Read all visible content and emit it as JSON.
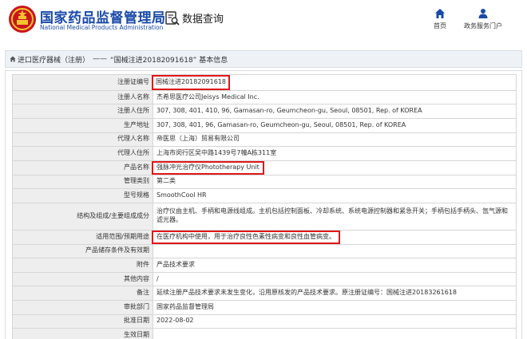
{
  "header": {
    "site_name_cn": "国家药品监督管理局",
    "site_name_en": "National Medical Products Administration",
    "data_query": "数据查询",
    "nav_home": "首页",
    "nav_portal": "政务服务门户"
  },
  "colors": {
    "brand": "#1a4aa8",
    "highlight": "#e0171b",
    "label_bg": "#eeeeee"
  },
  "breadcrumb": {
    "icon": "home-icon",
    "section": "进口医疗器械（注册）",
    "separator": "——",
    "current": "“国械注进20182091618” 基本信息"
  },
  "rows": [
    {
      "label": "注册证编号",
      "value": "国械注进20182091618"
    },
    {
      "label": "注册人名称",
      "value": "杰希思医疗公司Jeisys Medical Inc."
    },
    {
      "label": "注册人住所",
      "value": "307, 308, 401, 410, 96, Gamasan-ro, Geumcheon-gu, Seoul, 08501, Rep. of KOREA"
    },
    {
      "label": "生产地址",
      "value": "307, 308, 401, 96, Gamasan-ro, Geumcheon-gu, Seoul, 08501, Rep. of KOREA"
    },
    {
      "label": "代理人名称",
      "value": "帝医思（上海）贸易有限公司"
    },
    {
      "label": "代理人住所",
      "value": "上海市闵行区吴中路1439号7幢A栋311室"
    },
    {
      "label": "产品名称",
      "value": "强脉冲光治疗仪Phototherapy Unit"
    },
    {
      "label": "管理类别",
      "value": "第二类"
    },
    {
      "label": "型号规格",
      "value": "SmoothCool HR"
    },
    {
      "label": "结构及组成/主要组成成分",
      "value": "治疗仪由主机、手柄和电源线组成。主机包括控制面板、冷却系统、系统电源控制器和紧急开关；手柄包括手柄头、氙气源和滤光器。"
    },
    {
      "label": "适用范围/预期用途",
      "value": "在医疗机构中使用，用于治疗良性色素性病变和良性血管病变。"
    },
    {
      "label": "产品储存条件及有效期",
      "value": ""
    },
    {
      "label": "附件",
      "value": "产品技术要求"
    },
    {
      "label": "其他内容",
      "value": "/"
    },
    {
      "label": "备注",
      "value": "延续注册产品技术要求未发生变化，沿用原核发的产品技术要求。原注册证编号：国械注进20183261618"
    },
    {
      "label": "审批部门",
      "value": "国家药品监督管理局"
    },
    {
      "label": "批准日期",
      "value": "2022-08-02"
    },
    {
      "label": "生效日期",
      "value": ""
    }
  ]
}
